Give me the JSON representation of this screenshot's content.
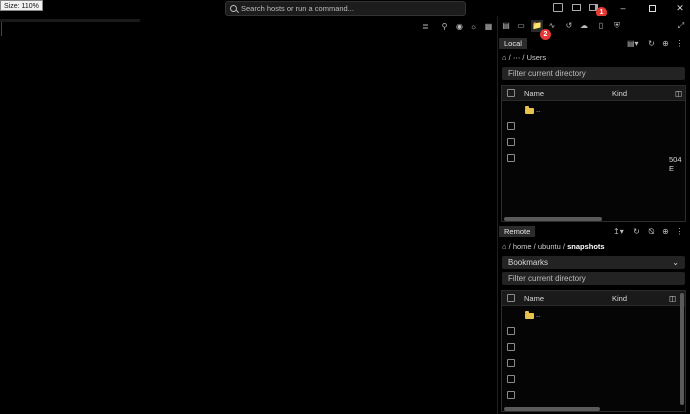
{
  "size_badge": "Size: 110%",
  "search": {
    "placeholder": "Search hosts or run a command..."
  },
  "badges": {
    "one": "1",
    "two": "2"
  },
  "local": {
    "label": "Local",
    "path_dots": "⋯",
    "path_sep": "/",
    "path_last": "Users",
    "filter": "Filter current directory",
    "columns": {
      "name": "Name",
      "kind": "Kind"
    },
    "rows": [
      {
        "name": "..",
        "kind": "",
        "extra": ""
      },
      {
        "name": "",
        "kind": "",
        "extra": ""
      },
      {
        "name": "",
        "kind": "",
        "extra": ""
      },
      {
        "name": "",
        "kind": "",
        "extra": "504 E"
      }
    ]
  },
  "remote": {
    "label": "Remote",
    "path": [
      "home",
      "ubuntu",
      "snapshots"
    ],
    "bookmarks": "Bookmarks",
    "filter": "Filter current directory",
    "columns": {
      "name": "Name",
      "kind": "Kind"
    },
    "rows": [
      {
        "name": ".."
      },
      {
        "name": ""
      },
      {
        "name": ""
      },
      {
        "name": ""
      },
      {
        "name": ""
      },
      {
        "name": ""
      }
    ]
  },
  "icons": {
    "titlebar": [
      "files-icon",
      "layout-icon",
      "sidebar-icon"
    ],
    "window": [
      "minimize-icon",
      "maximize-icon",
      "close-icon"
    ],
    "panel_tabs": [
      "server-icon",
      "snippet-icon",
      "sftp-folder-icon",
      "activity-icon",
      "history-icon",
      "cloud-icon",
      "trash-icon",
      "shield-icon",
      "fullscreen-icon"
    ]
  },
  "colors": {
    "accent_badge": "#e53935",
    "folder": "#e8c24a",
    "background": "#000000"
  }
}
